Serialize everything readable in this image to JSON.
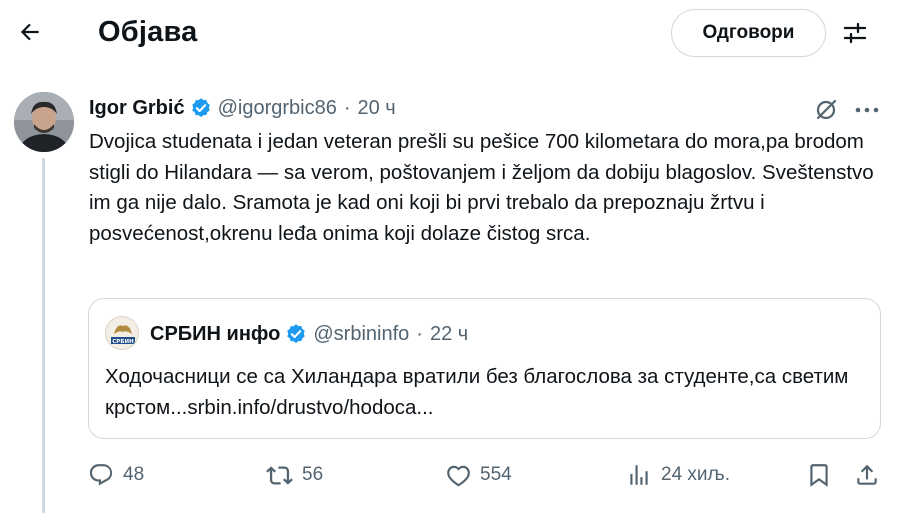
{
  "header": {
    "title": "Објава",
    "reply_button": "Одговори",
    "back_icon": "arrow-left-icon",
    "filter_icon": "sliders-icon"
  },
  "post": {
    "author_name": "Igor Grbić",
    "handle": "@igorgrbic86",
    "separator": "·",
    "time": "20 ч",
    "text": "Dvojica studenata i jedan veteran prešli su pešice 700 kilometara do mora,pa brodom stigli do Hilandara — sa verom, poštovanjem i željom da dobiju blagoslov. Sveštenstvo im ga nije dalo. Sramota je kad oni koji bi prvi trebalo da prepoznaju žrtvu i posvećenost,okrenu leđa onima koji dolaze čistog srca."
  },
  "quote": {
    "author_name": "СРБИН инфо",
    "avatar_text": "СРБИН",
    "handle": "@srbininfo",
    "separator": "·",
    "time": "22 ч",
    "text": "Ходочасници се са Хиландара вратили без благослова за студенте,са светим крстом...srbin.info/drustvo/hodoca..."
  },
  "actions": {
    "replies": "48",
    "reposts": "56",
    "likes": "554",
    "views": "24 хиљ."
  },
  "colors": {
    "text": "#0f1419",
    "secondary": "#536471",
    "border": "#cfd9de",
    "verified": "#1d9bf0"
  }
}
